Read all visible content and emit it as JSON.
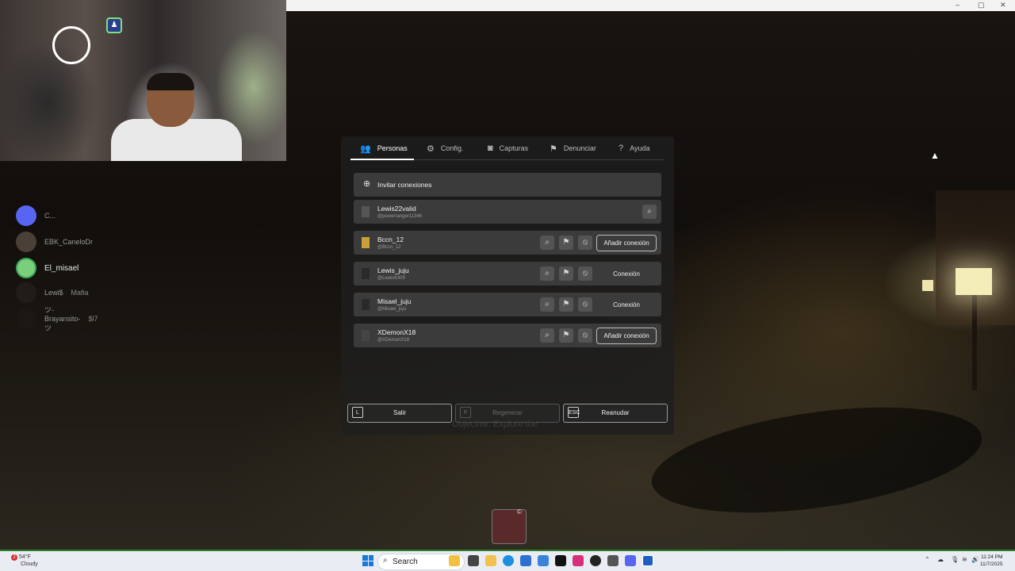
{
  "menu": {
    "tabs": [
      {
        "label": "Personas",
        "icon": "people-icon"
      },
      {
        "label": "Config.",
        "icon": "gear-icon"
      },
      {
        "label": "Capturas",
        "icon": "camera-icon"
      },
      {
        "label": "Denunciar",
        "icon": "flag-icon"
      },
      {
        "label": "Ayuda",
        "icon": "help-icon"
      }
    ],
    "invite_label": "Invitar conexiones",
    "players": [
      {
        "name": "Lewis22valid",
        "handle": "@powerranger11346",
        "action": ""
      },
      {
        "name": "Bccn_12",
        "handle": "@Bccn_12",
        "action": "Añadir conexión"
      },
      {
        "name": "Lewis_juju",
        "handle": "@Lewis6309",
        "action": "Conexión"
      },
      {
        "name": "Misael_juju",
        "handle": "@Misael_juju",
        "action": "Conexión"
      },
      {
        "name": "XDemonX18",
        "handle": "@XDemonX18",
        "action": "Añadir conexión"
      }
    ],
    "bottom_buttons": [
      {
        "key": "L",
        "label": "Salir",
        "enabled": true
      },
      {
        "key": "R",
        "label": "Regenerar",
        "enabled": false
      },
      {
        "key": "ESC",
        "label": "Reanudar",
        "enabled": true
      }
    ]
  },
  "objective": "Objective: Explore the",
  "voice_users": [
    {
      "name": "C...",
      "tag": ""
    },
    {
      "name": "EBK_CaneloDr",
      "tag": ""
    },
    {
      "name": "El_misael",
      "tag": ""
    },
    {
      "name": "Lewi$",
      "tag": "Mafia"
    },
    {
      "name": "ツ-Brayansito-ツ",
      "tag": "$l7"
    }
  ],
  "taskbar": {
    "weather_temp": "54°F",
    "weather_desc": "Cloudy",
    "weather_badge": "2",
    "search_placeholder": "Search",
    "time": "11:24 PM",
    "date": "11/7/2025"
  },
  "colors": {
    "panel_bg": "#1e1e1e",
    "row_bg": "#3b3b3b",
    "taskbar_bg": "#e9edf3",
    "accent_green": "#2e7d2e"
  }
}
